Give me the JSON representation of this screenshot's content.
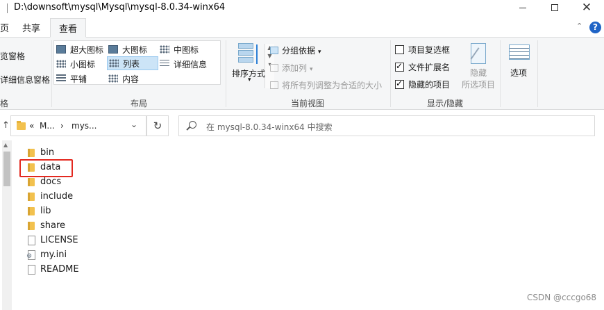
{
  "window": {
    "title": "D:\\downsoft\\mysql\\Mysql\\mysql-8.0.34-winx64",
    "minimize_icon": "minimize-icon",
    "maximize_icon": "maximize-icon",
    "close_glyph": "✕"
  },
  "tabs": [
    {
      "label": "页"
    },
    {
      "label": "共享"
    },
    {
      "label": "查看",
      "active": true
    }
  ],
  "ribbon": {
    "collapse_glyph": "⌃",
    "help_glyph": "?",
    "pane": {
      "preview_pane": "览窗格",
      "details_pane": "详细信息窗格",
      "group_label": "格"
    },
    "layout": {
      "group_label": "布局",
      "items": [
        {
          "label": "超大图标",
          "icon": "extra-large-icons-icon"
        },
        {
          "label": "大图标",
          "icon": "large-icons-icon"
        },
        {
          "label": "中图标",
          "icon": "medium-icons-icon"
        },
        {
          "label": "小图标",
          "icon": "small-icons-icon"
        },
        {
          "label": "列表",
          "icon": "list-icon",
          "selected": true
        },
        {
          "label": "详细信息",
          "icon": "details-icon"
        },
        {
          "label": "平铺",
          "icon": "tiles-icon"
        },
        {
          "label": "内容",
          "icon": "content-icon"
        }
      ]
    },
    "current_view": {
      "group_label": "当前视图",
      "sort_by": "排序方式",
      "group_by": "分组依据",
      "add_columns": "添加列",
      "size_all_columns": "将所有列调整为合适的大小"
    },
    "show_hide": {
      "group_label": "显示/隐藏",
      "item_checkboxes": {
        "label": "项目复选框",
        "checked": false
      },
      "file_extensions": {
        "label": "文件扩展名",
        "checked": true
      },
      "hidden_items": {
        "label": "隐藏的项目",
        "checked": true
      },
      "hide_selected_line1": "隐藏",
      "hide_selected_line2": "所选项目"
    },
    "options_label": "选项"
  },
  "address": {
    "up_glyph": "↑",
    "crumb_prefix": "«",
    "crumbs": [
      "M...",
      "mys..."
    ],
    "separator": "›",
    "dropdown_glyph": "⌄",
    "refresh_glyph": "↻",
    "search_placeholder": "在 mysql-8.0.34-winx64 中搜索"
  },
  "files": [
    {
      "name": "bin",
      "type": "folder"
    },
    {
      "name": "data",
      "type": "folder",
      "highlighted": true
    },
    {
      "name": "docs",
      "type": "folder"
    },
    {
      "name": "include",
      "type": "folder"
    },
    {
      "name": "lib",
      "type": "folder"
    },
    {
      "name": "share",
      "type": "folder"
    },
    {
      "name": "LICENSE",
      "type": "file"
    },
    {
      "name": "my.ini",
      "type": "ini"
    },
    {
      "name": "README",
      "type": "file"
    }
  ],
  "watermark": "CSDN @cccgo68",
  "colors": {
    "highlight": "#e3281f",
    "selection": "#cce4f7",
    "folder": "#f2c14e",
    "help": "#1f64c6"
  }
}
